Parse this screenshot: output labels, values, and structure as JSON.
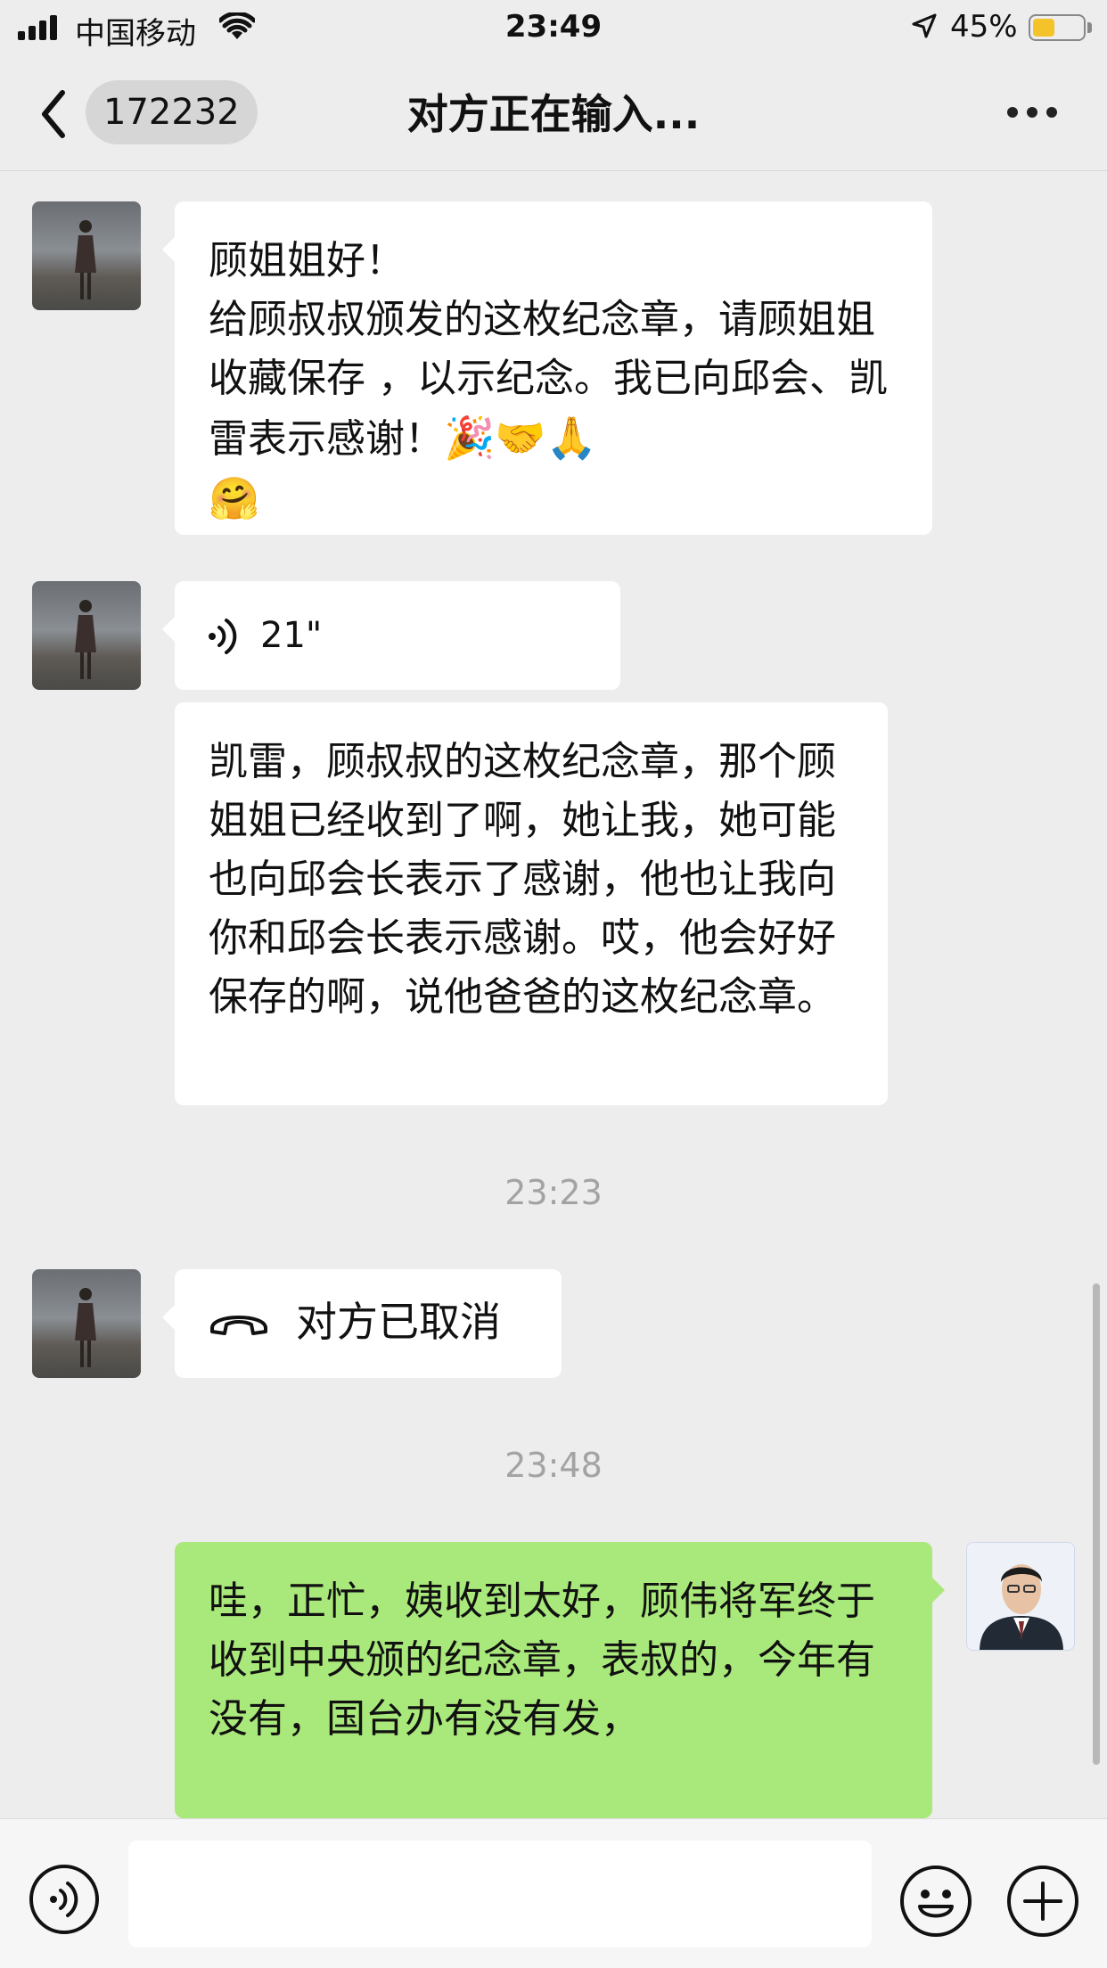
{
  "status_bar": {
    "carrier": "中国移动",
    "time": "23:49",
    "battery_percent": "45%",
    "battery_level": 0.45,
    "icons": [
      "signal-icon",
      "wifi-icon",
      "location-icon",
      "battery-icon"
    ]
  },
  "nav": {
    "unread_badge": "172232",
    "title": "对方正在输入...",
    "icons": [
      "back-chevron-icon",
      "more-dots-icon"
    ]
  },
  "messages": {
    "m1": {
      "side": "received",
      "line1": "顾姐姐好！",
      "body": "给顾叔叔颁发的这枚纪念章，请顾姐姐收藏保存 ，以示纪念。我已向邱会、凯雷表示感谢！",
      "emojis": "🎉🤝🙏",
      "emoji_line2": "🤗"
    },
    "m2": {
      "side": "received",
      "type": "voice",
      "duration": "21\""
    },
    "m3": {
      "side": "received",
      "text": "凯雷，顾叔叔的这枚纪念章，那个顾姐姐已经收到了啊，她让我，她可能也向邱会长表示了感谢，他也让我向你和邱会长表示感谢。哎，他会好好保存的啊，说他爸爸的这枚纪念章。"
    },
    "t1": "23:23",
    "m4": {
      "side": "received",
      "type": "call",
      "text": "对方已取消"
    },
    "t2": "23:48",
    "m5": {
      "side": "sent",
      "text": "哇，正忙，姨收到太好，顾伟将军终于收到中央颁的纪念章，表叔的，今年有没有，国台办有没有发，"
    }
  },
  "colors": {
    "background": "#ededed",
    "sent_bubble": "#a9e87a",
    "received_bubble": "#ffffff",
    "timestamp": "#a3a3a3"
  },
  "input_bar": {
    "icons": [
      "voice-input-icon",
      "emoji-icon",
      "plus-icon"
    ]
  }
}
